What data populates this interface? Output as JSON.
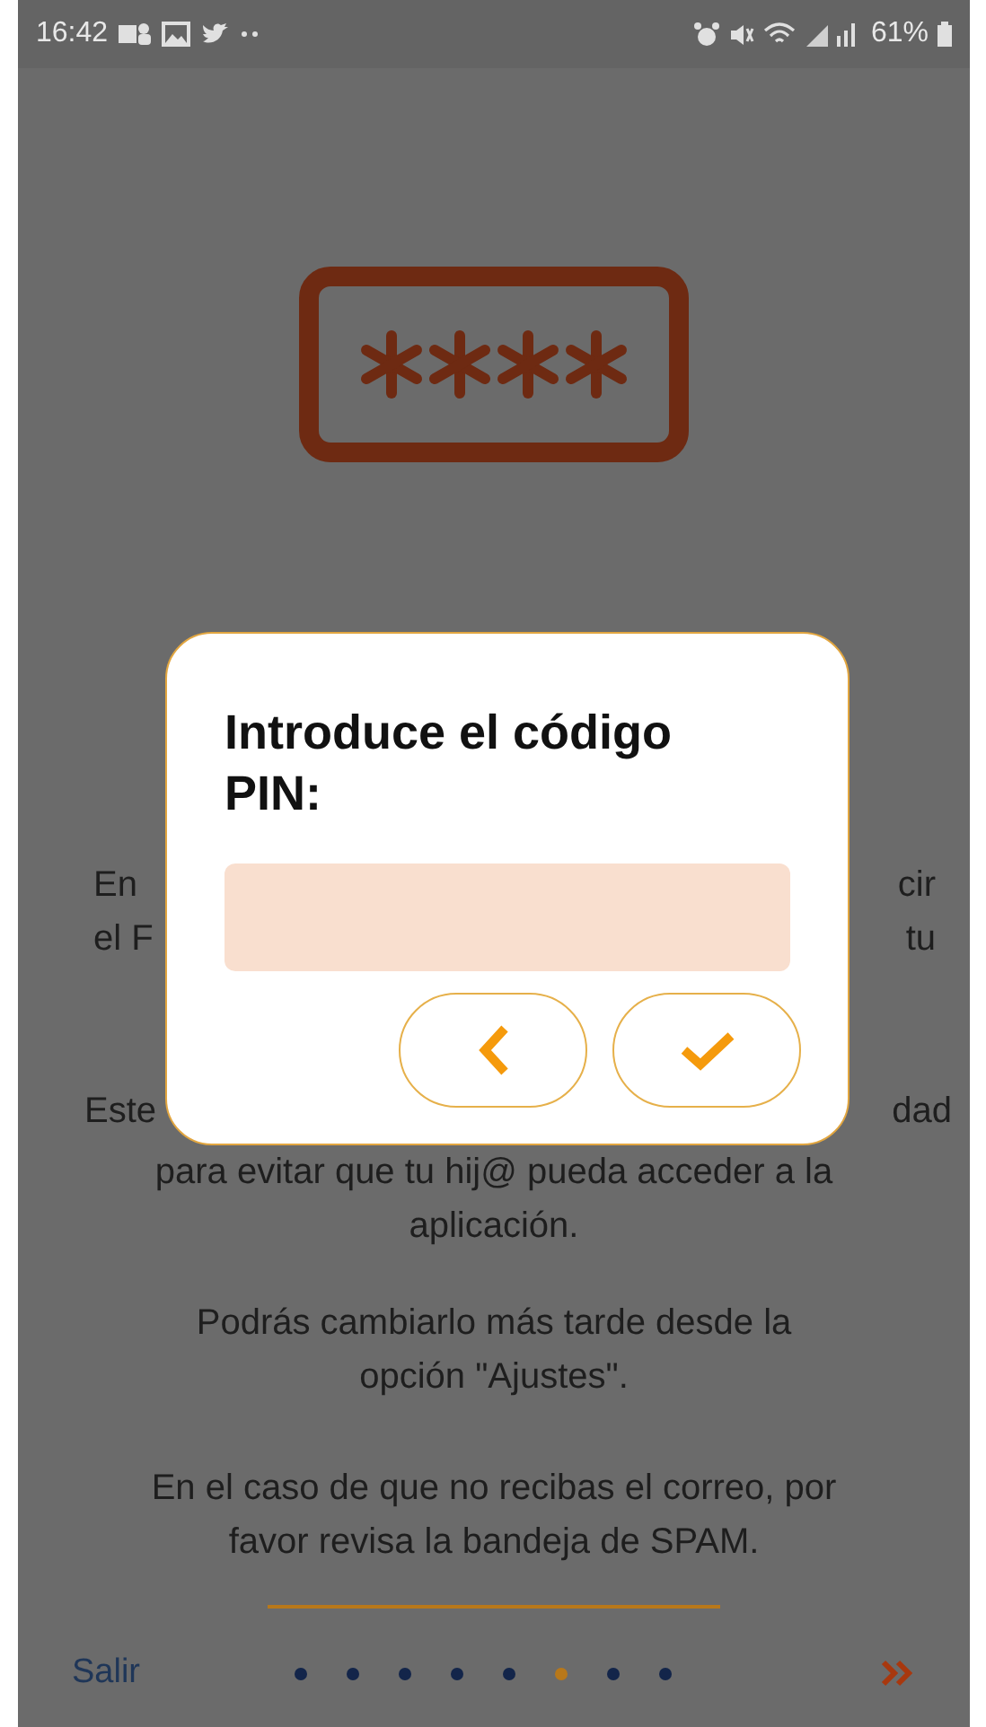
{
  "status_bar": {
    "time": "16:42",
    "battery": "61%"
  },
  "background_text": {
    "paragraph_1": [
      {
        "left": "En",
        "right": "cir"
      },
      {
        "left": "el F",
        "right": "tu"
      }
    ],
    "paragraph_2": [
      {
        "left": "Este",
        "right": "dad"
      }
    ],
    "paragraph_2_rest": [
      "para evitar que tu hij@ pueda acceder a la",
      "aplicación."
    ],
    "paragraph_3": [
      "Podrás cambiarlo más tarde desde la",
      "opción \"Ajustes\"."
    ],
    "paragraph_4": [
      "En el caso de que no recibas el correo, por",
      "favor revisa la bandeja de SPAM."
    ]
  },
  "dialog": {
    "title": "Introduce el código PIN:"
  },
  "footer": {
    "exit_link": "Salir",
    "pages": [
      {
        "selected": false
      },
      {
        "selected": false
      },
      {
        "selected": false
      },
      {
        "selected": false
      },
      {
        "selected": false
      },
      {
        "selected": true
      },
      {
        "selected": false
      },
      {
        "selected": false
      }
    ]
  }
}
